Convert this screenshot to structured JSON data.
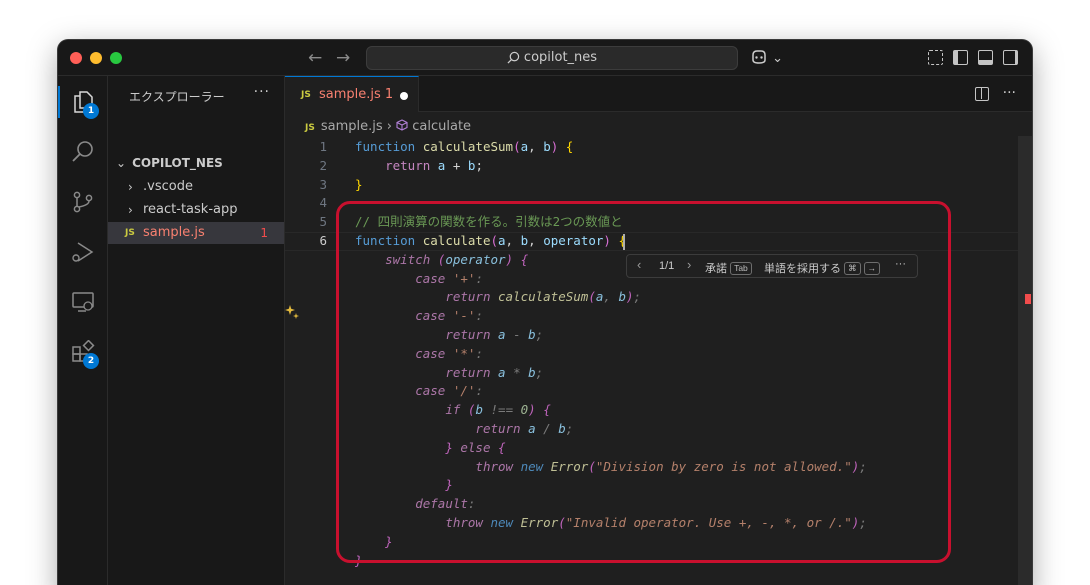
{
  "titlebar": {
    "search_text": "copilot_nes",
    "copilot_chevron": "⌄"
  },
  "activity": {
    "explorer_badge": "1",
    "extensions_badge": "2"
  },
  "sidebar": {
    "title": "エクスプローラー",
    "more": "···",
    "folder": "COPILOT_NES",
    "items": [
      {
        "label": ".vscode",
        "chevron": "›"
      },
      {
        "label": "react-task-app",
        "chevron": "›"
      },
      {
        "label": "sample.js",
        "icon": "JS",
        "problems": "1"
      }
    ]
  },
  "editor": {
    "tab": {
      "icon": "JS",
      "label": "sample.js 1"
    },
    "more": "···",
    "breadcrumb": {
      "icon": "JS",
      "file": "sample.js",
      "separator": "›",
      "symbol": "calculate"
    },
    "line_numbers": [
      "1",
      "2",
      "3",
      "4",
      "5",
      "6"
    ],
    "code_lines": [
      "function calculateSum(a, b) {",
      "    return a + b;",
      "}",
      "",
      "// 四則演算の関数を作る。引数は2つの数値と",
      "function calculate(a, b, operator) {"
    ],
    "ghost_lines": [
      "    switch (operator) {",
      "        case '+':",
      "            return calculateSum(a, b);",
      "        case '-':",
      "            return a - b;",
      "        case '*':",
      "            return a * b;",
      "        case '/':",
      "            if (b !== 0) {",
      "                return a / b;",
      "            } else {",
      "                throw new Error(\"Division by zero is not allowed.\");",
      "            }",
      "        default:",
      "            throw new Error(\"Invalid operator. Use +, -, *, or /.\");",
      "    }",
      "}"
    ]
  },
  "suggestion_bar": {
    "prev": "‹",
    "counter": "1/1",
    "next": "›",
    "accept_label": "承諾",
    "accept_key": "Tab",
    "accept_word_label": "単語を採用する",
    "accept_word_key1": "⌘",
    "accept_word_key2": "→",
    "more": "···"
  },
  "colors": {
    "accent": "#0078d4",
    "highlight": "#c8102e",
    "error": "#f14c4c"
  }
}
